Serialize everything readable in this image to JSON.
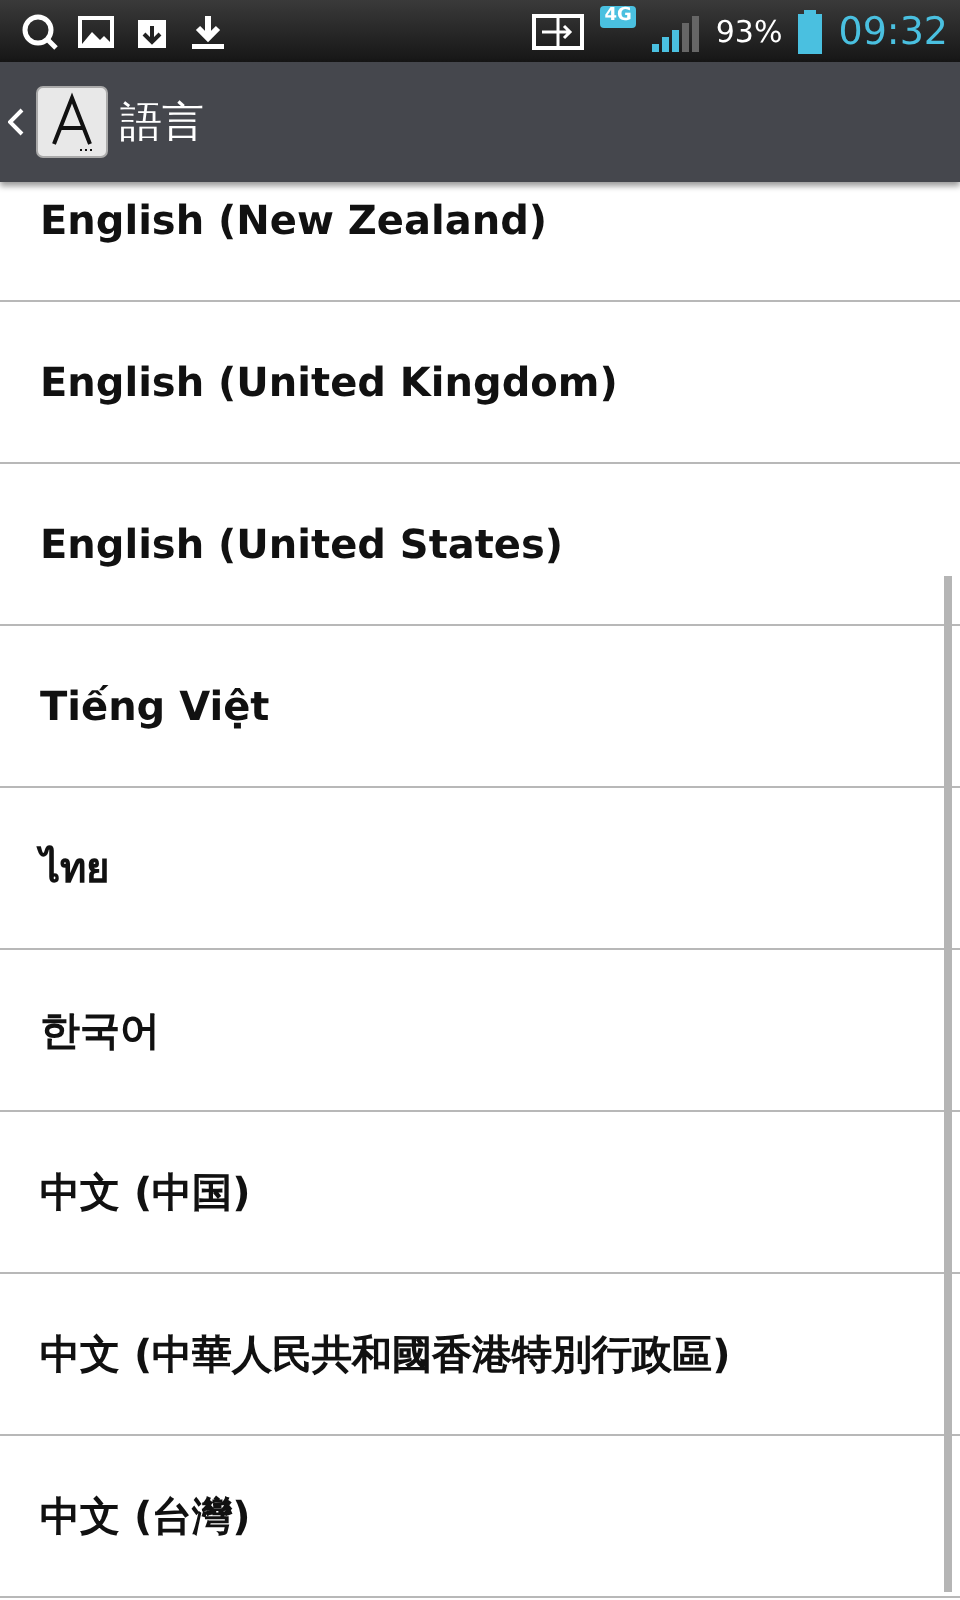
{
  "status_bar": {
    "network": "4G",
    "battery": "93%",
    "time": "09:32"
  },
  "action_bar": {
    "title": "語言"
  },
  "languages": [
    {
      "label": "English (New Zealand)"
    },
    {
      "label": "English (United Kingdom)"
    },
    {
      "label": "English (United States)"
    },
    {
      "label": "Tiếng Việt"
    },
    {
      "label": "ไทย"
    },
    {
      "label": "한국어"
    },
    {
      "label": "中文 (中国)"
    },
    {
      "label": "中文 (中華人民共和國香港特別行政區)"
    },
    {
      "label": "中文 (台灣)"
    }
  ]
}
